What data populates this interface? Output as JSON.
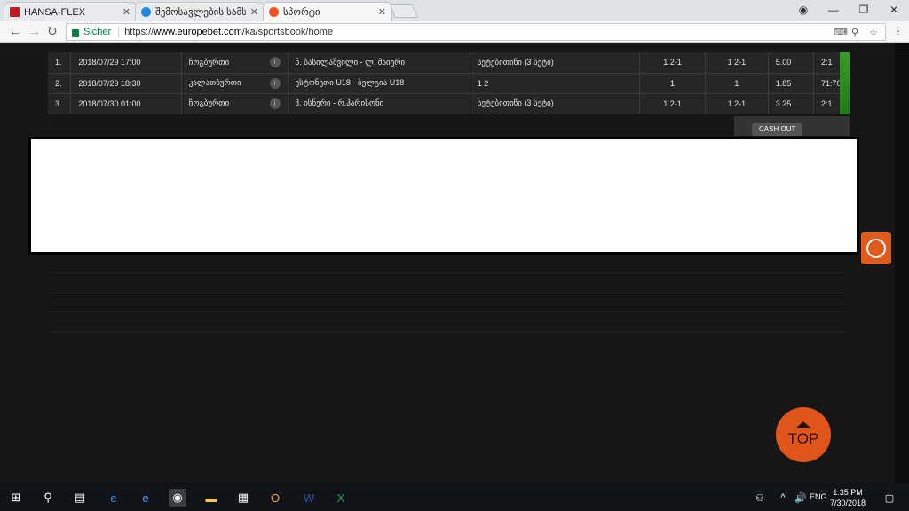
{
  "tabs": [
    {
      "title": "HANSA-FLEX",
      "favicon_color": "#c4161c"
    },
    {
      "title": "შემოსავლების სამსახ",
      "favicon_color": "#1e88e5"
    },
    {
      "title": "სპორტი",
      "favicon_color": "#f4511e"
    }
  ],
  "addressbar": {
    "secure_label": "Sicher",
    "url_prefix": "https://",
    "url_domain": "www.europebet.com",
    "url_path": "/ka/sportsbook/home"
  },
  "bets": [
    {
      "num": "1.",
      "datetime": "2018/07/29 17:00",
      "sport": "ჩოგბურთი",
      "match": "ნ. ბასილაშვილი - ლ. მაიერი",
      "market": "სეტებითიწი (3 სეტი)",
      "pick1": "1 2-1",
      "pick2": "1 2-1",
      "odds": "5.00",
      "score": "2:1"
    },
    {
      "num": "2.",
      "datetime": "2018/07/29 18:30",
      "sport": "კალათბურთი",
      "match": "ესტონეთი U18 - ბელგია U18",
      "market": "1 2",
      "pick1": "1",
      "pick2": "1",
      "odds": "1.85",
      "score": "71:70"
    },
    {
      "num": "3.",
      "datetime": "2018/07/30 01:00",
      "sport": "ჩოგბურთი",
      "match": "ჰ. ისნერი - რ.ჰარისონი",
      "market": "სეტებითიწი (3 სეტი)",
      "pick1": "1 2-1",
      "pick2": "1 2-1",
      "odds": "3.25",
      "score": "2:1"
    }
  ],
  "cashout": {
    "label1": "CASH",
    "label2": "OUT"
  },
  "top_button": "TOP",
  "taskbar": {
    "lang": "ENG",
    "time": "1:35 PM",
    "date": "7/30/2018"
  },
  "colors": {
    "accent": "#e0561a",
    "green": "#2f8f22"
  }
}
